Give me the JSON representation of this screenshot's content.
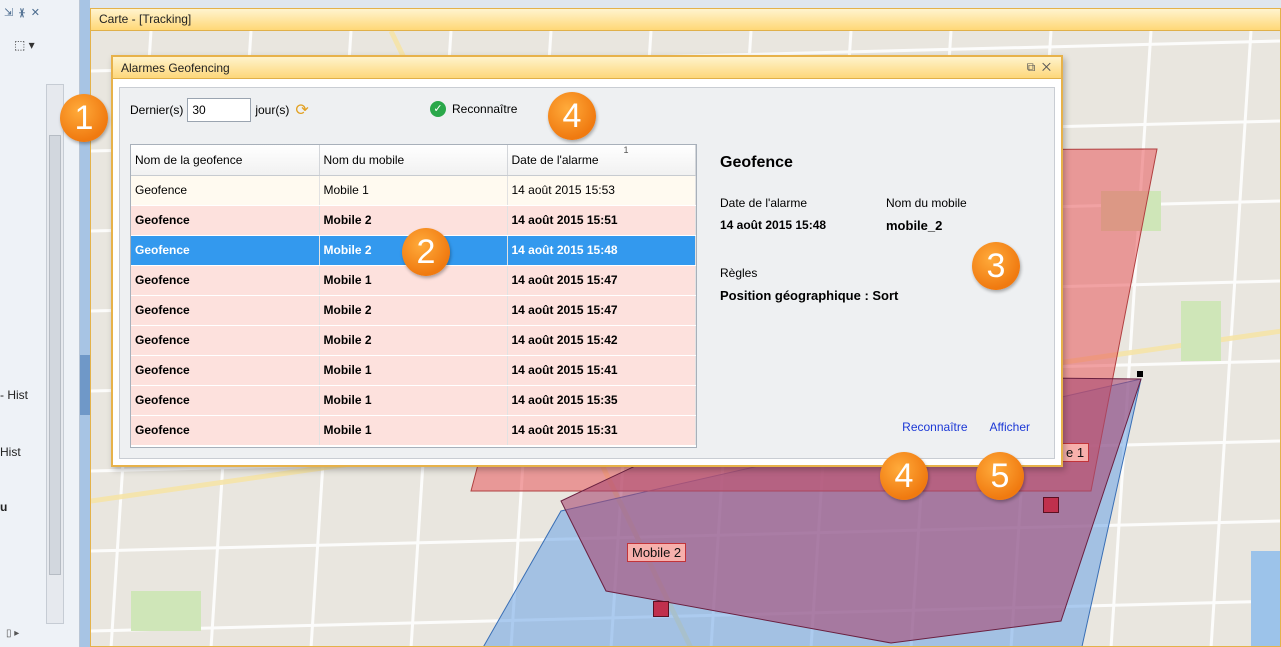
{
  "left_panel": {
    "toolbar_icons": [
      "pin-icon",
      "float-icon",
      "close-icon"
    ],
    "labels": [
      "- Hist",
      "Hist",
      "u"
    ]
  },
  "map_window": {
    "title": "Carte - [Tracking]",
    "labels": [
      {
        "text": "Mobile 2"
      },
      {
        "text": "e 1"
      }
    ]
  },
  "dialog": {
    "title": "Alarmes Geofencing",
    "filter": {
      "prefix": "Dernier(s)",
      "days_value": "30",
      "suffix": "jour(s)"
    },
    "acknowledge_top": "Reconnaître",
    "sort_hint": "1",
    "table": {
      "columns": [
        "Nom de la geofence",
        "Nom du mobile",
        "Date de l'alarme"
      ],
      "rows": [
        {
          "geofence": "Geofence",
          "mobile": "Mobile 1",
          "date": "14 août 2015  15:53",
          "state": "read"
        },
        {
          "geofence": "Geofence",
          "mobile": "Mobile 2",
          "date": "14 août 2015  15:51",
          "state": "unread"
        },
        {
          "geofence": "Geofence",
          "mobile": "Mobile 2",
          "date": "14 août 2015  15:48",
          "state": "selected"
        },
        {
          "geofence": "Geofence",
          "mobile": "Mobile 1",
          "date": "14 août 2015  15:47",
          "state": "unread"
        },
        {
          "geofence": "Geofence",
          "mobile": "Mobile 2",
          "date": "14 août 2015  15:47",
          "state": "unread"
        },
        {
          "geofence": "Geofence",
          "mobile": "Mobile 2",
          "date": "14 août 2015  15:42",
          "state": "unread"
        },
        {
          "geofence": "Geofence",
          "mobile": "Mobile 1",
          "date": "14 août 2015  15:41",
          "state": "unread"
        },
        {
          "geofence": "Geofence",
          "mobile": "Mobile 1",
          "date": "14 août 2015  15:35",
          "state": "unread"
        },
        {
          "geofence": "Geofence",
          "mobile": "Mobile 1",
          "date": "14 août 2015  15:31",
          "state": "unread"
        }
      ]
    },
    "details": {
      "heading": "Geofence",
      "date_label": "Date de l'alarme",
      "date_value": "14 août 2015  15:48",
      "mobile_label": "Nom du mobile",
      "mobile_value": "mobile_2",
      "rules_label": "Règles",
      "rules_value": "Position géographique : Sort"
    },
    "links": {
      "acknowledge": "Reconnaître",
      "show": "Afficher"
    }
  },
  "callouts": [
    "1",
    "2",
    "3",
    "4",
    "4",
    "5"
  ],
  "colors": {
    "accent_orange": "#f07a10",
    "selection_blue": "#3399ee",
    "unread_row": "#fde1dd",
    "zone_red": "#e8575b",
    "zone_blue": "#6aa2e6",
    "zone_purple": "#a84a73"
  }
}
